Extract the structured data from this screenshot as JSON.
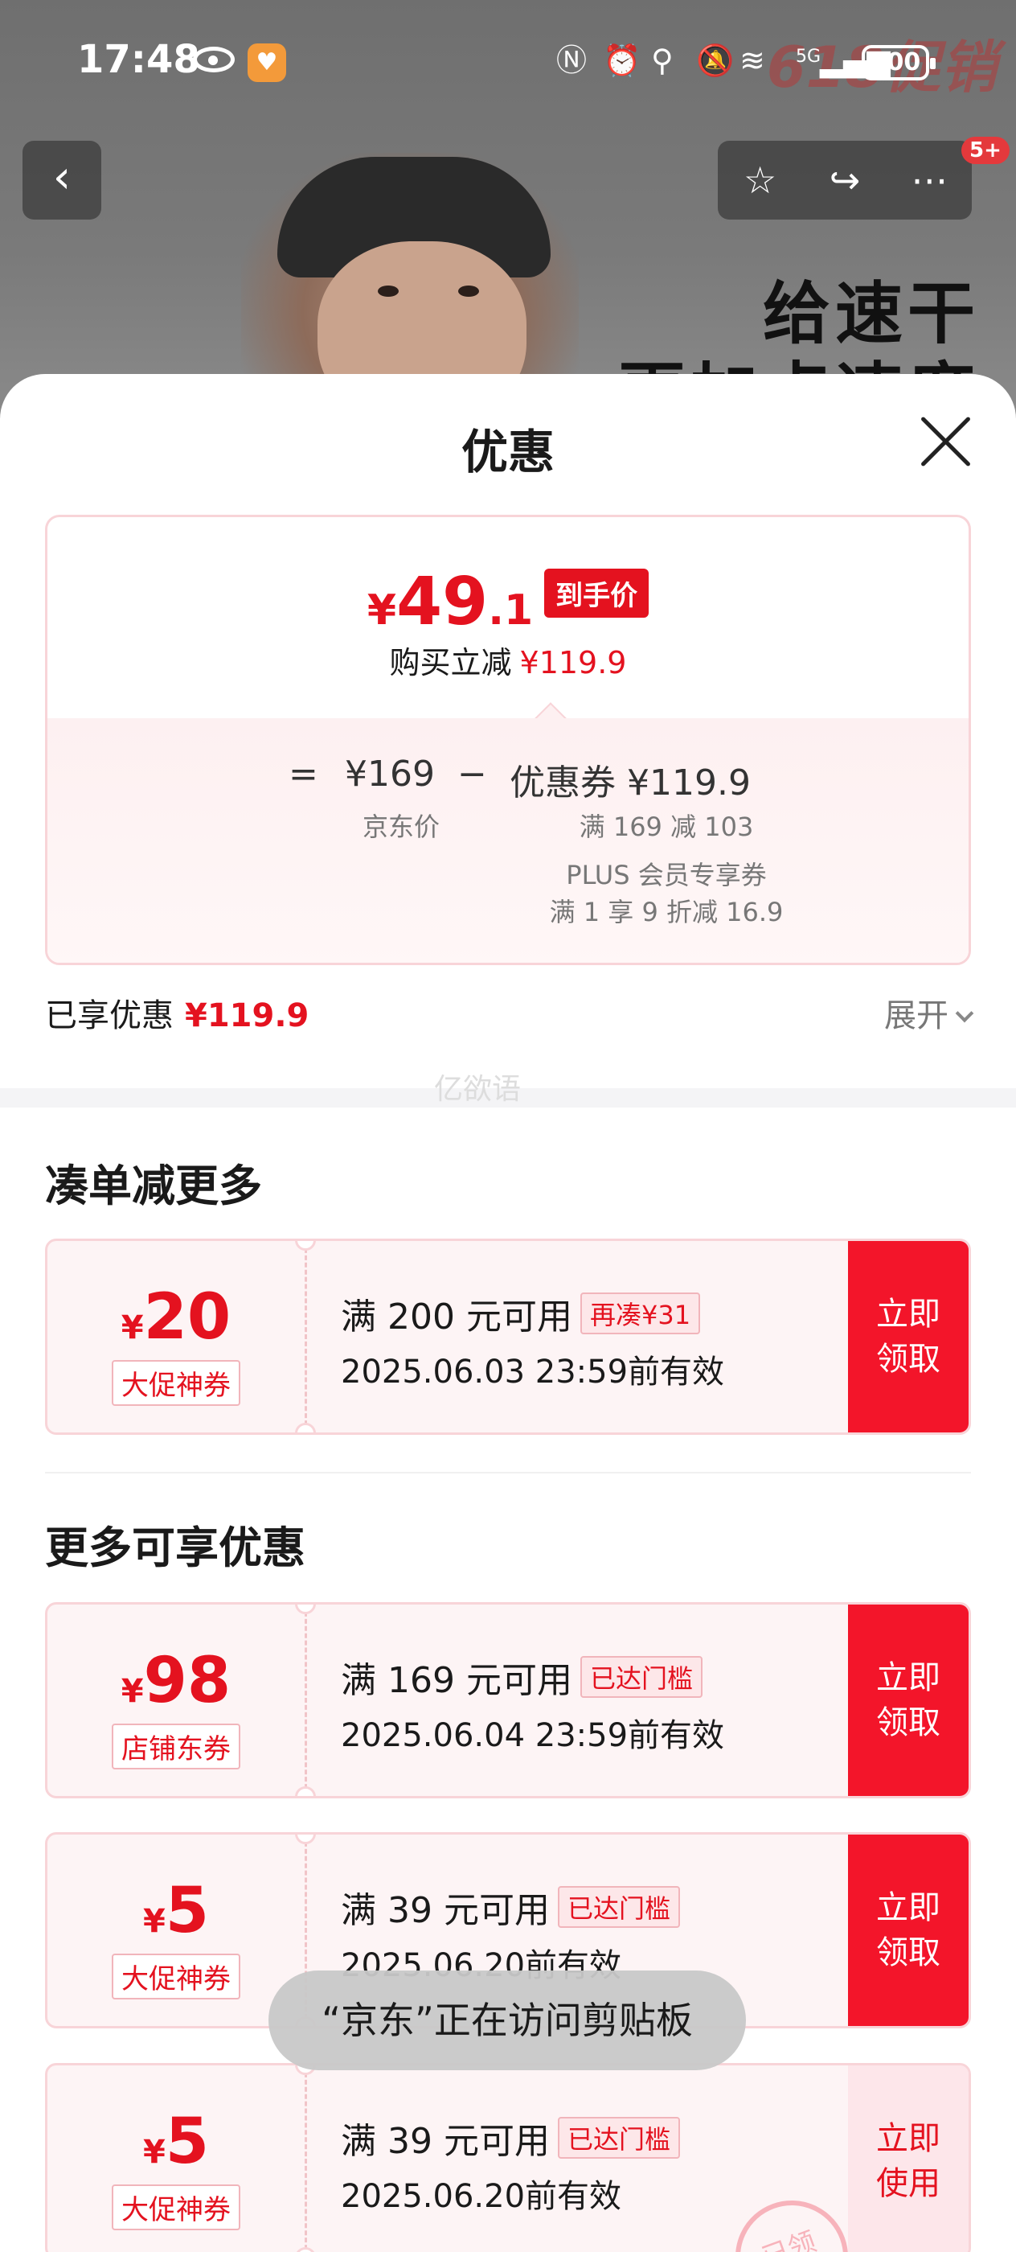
{
  "status_bar": {
    "time": "17:48",
    "battery": "100",
    "network": "5G"
  },
  "background_page": {
    "slogan": "给速干\n更加点速度",
    "badge_count": "5+"
  },
  "sheet": {
    "title": "优惠",
    "price_card": {
      "symbol": "¥",
      "price_int": "49",
      "price_dec": ".1",
      "price_tag": "到手价",
      "reduce_label": "购买立减",
      "reduce_amount": "¥119.9",
      "equals": "=",
      "jd_price": "¥169",
      "minus": "−",
      "coupon_label": "优惠券 ¥119.9",
      "jd_price_label": "京东价",
      "coupon_detail_1": "满 169 减 103",
      "coupon_detail_2": "PLUS 会员专享券",
      "coupon_detail_3": "满 1 享 9 折减 16.9"
    },
    "enjoyed": {
      "label": "已享优惠",
      "amount": "¥119.9",
      "expand": "展开"
    },
    "watermark": "亿欲语",
    "section1_title": "凑单减更多",
    "section2_title": "更多可享优惠",
    "coupons": [
      {
        "symbol": "¥",
        "amount": "20",
        "type": "大促神券",
        "condition": "满 200 元可用",
        "tag": "再凑¥31",
        "valid": "2025.06.03 23:59前有效",
        "button": "立即\n领取"
      },
      {
        "symbol": "¥",
        "amount": "98",
        "type": "店铺东券",
        "condition": "满 169 元可用",
        "tag": "已达门槛",
        "valid": "2025.06.04 23:59前有效",
        "button": "立即\n领取"
      },
      {
        "symbol": "¥",
        "amount": "5",
        "type": "大促神券",
        "condition": "满 39 元可用",
        "tag": "已达门槛",
        "valid": "2025.06.20前有效",
        "button": "立即\n领取"
      },
      {
        "symbol": "¥",
        "amount": "5",
        "type": "大促神券",
        "condition": "满 39 元可用",
        "tag": "已达门槛",
        "valid": "2025.06.20前有效",
        "button": "立即\n使用",
        "stamp": "已领"
      }
    ],
    "toast": "“京东”正在访问剪贴板"
  },
  "colors": {
    "brand_red": "#e4121f",
    "coupon_bg": "#fdf4f5",
    "border_pink": "#f8d4d8"
  }
}
